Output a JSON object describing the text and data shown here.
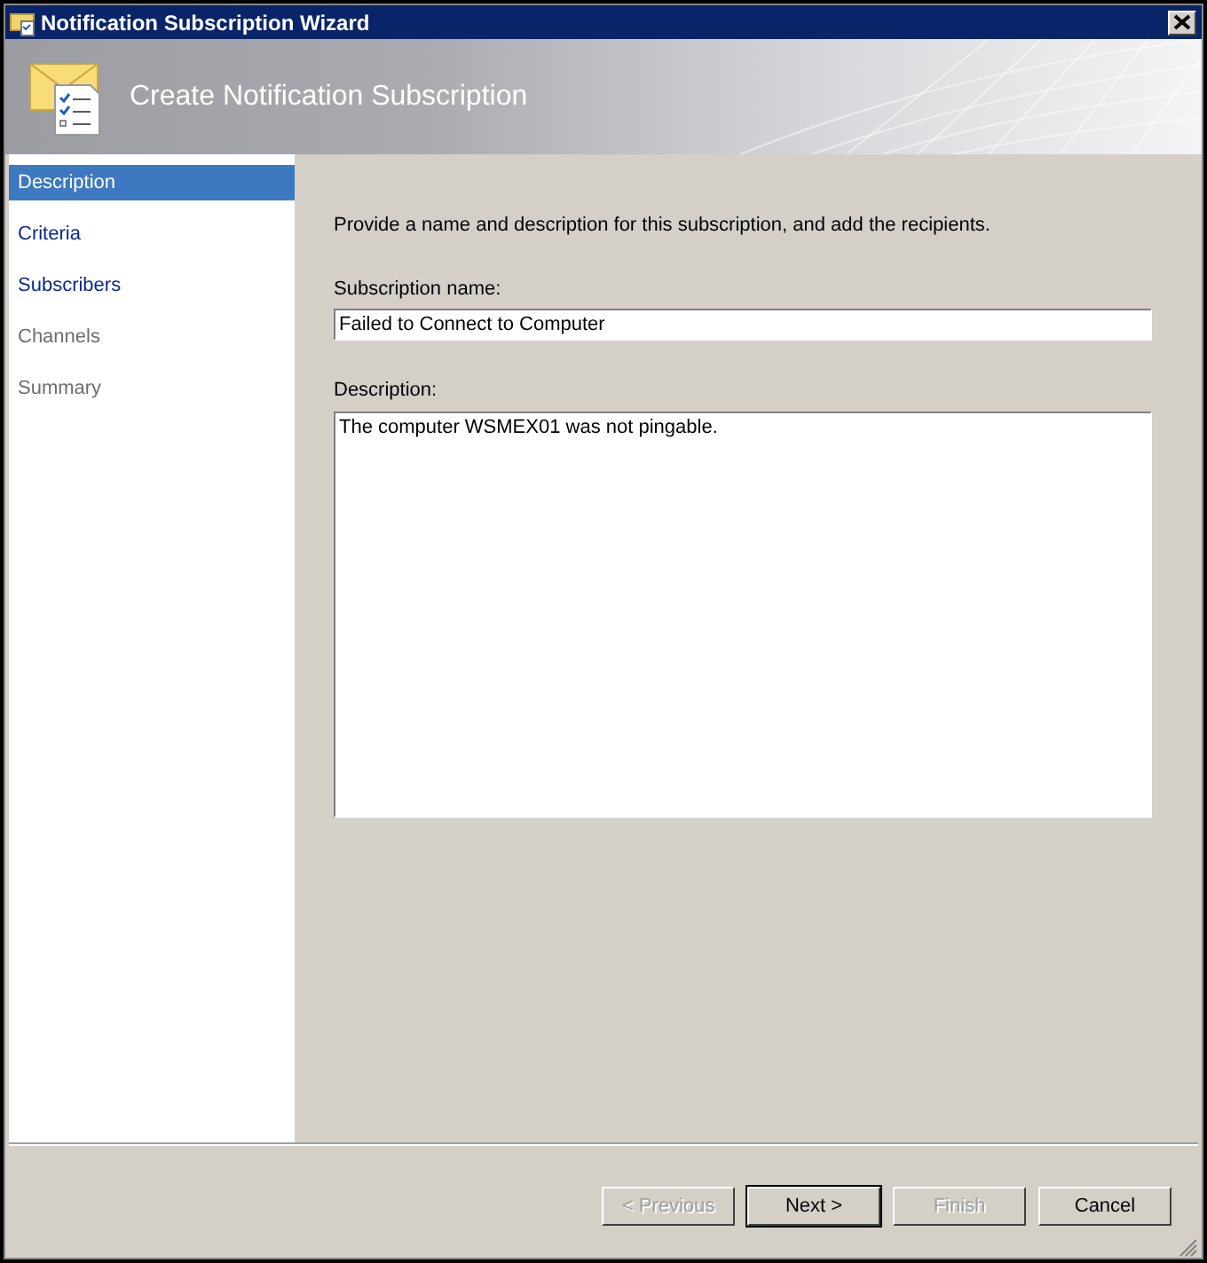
{
  "window": {
    "title": "Notification Subscription Wizard"
  },
  "header": {
    "title": "Create Notification Subscription"
  },
  "sidebar": {
    "items": [
      {
        "label": "Description",
        "selected": true,
        "enabled": true
      },
      {
        "label": "Criteria",
        "selected": false,
        "enabled": true
      },
      {
        "label": "Subscribers",
        "selected": false,
        "enabled": true
      },
      {
        "label": "Channels",
        "selected": false,
        "enabled": false
      },
      {
        "label": "Summary",
        "selected": false,
        "enabled": false
      }
    ]
  },
  "content": {
    "instruction": "Provide a name and description for this subscription, and add the recipients.",
    "name_label": "Subscription name:",
    "name_value": "Failed to Connect to Computer",
    "description_label": "Description:",
    "description_value": "The computer WSMEX01 was not pingable."
  },
  "buttons": [
    {
      "label": "< Previous",
      "disabled": true,
      "default": false
    },
    {
      "label": "Next >",
      "disabled": false,
      "default": true
    },
    {
      "label": "Finish",
      "disabled": true,
      "default": false
    },
    {
      "label": "Cancel",
      "disabled": false,
      "default": false
    }
  ]
}
